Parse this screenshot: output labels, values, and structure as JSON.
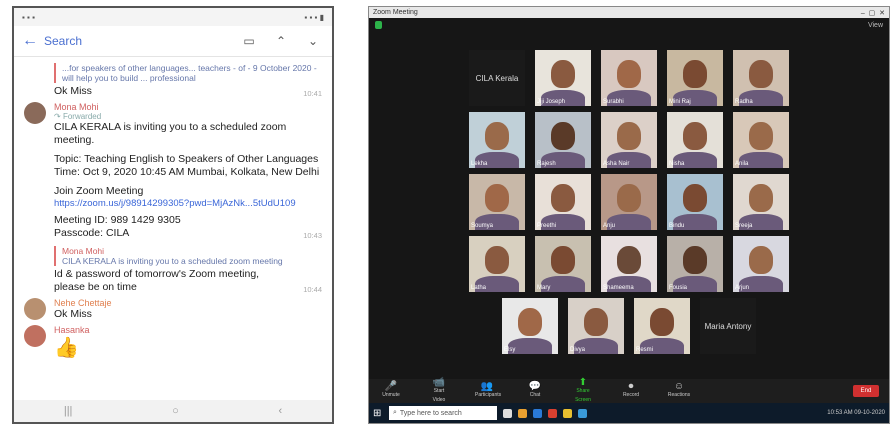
{
  "phone": {
    "topbar": {
      "search_label": "Search"
    },
    "messages": [
      {
        "type": "quote",
        "text": "...for speakers of other languages... teachers - of - 9 October 2020 - will help you to build ... professional"
      },
      {
        "type": "plain",
        "text": "Ok Miss",
        "time": "10:41"
      },
      {
        "type": "message",
        "sender": "Mona Mohi",
        "forwarded": "Forwarded",
        "lines": [
          "CILA KERALA is inviting you to a scheduled zoom meeting.",
          "",
          "Topic: Teaching English to Speakers of Other Languages",
          "Time: Oct 9, 2020 10:45 AM Mumbai, Kolkata, New Delhi",
          "",
          "Join Zoom Meeting"
        ],
        "link": "https://zoom.us/j/98914299305?pwd=MjAzNk...5tUdU109",
        "meeting_id": "Meeting ID: 989 1429 9305",
        "passcode": "Passcode: CILA",
        "time": "10:43"
      },
      {
        "type": "quote",
        "sender": "Mona Mohi",
        "text": "CILA KERALA is inviting you to a scheduled zoom meeting"
      },
      {
        "type": "plain",
        "text": "Id & password of tomorrow's Zoom meeting, please be on time",
        "time": "10:44"
      },
      {
        "type": "message-short",
        "sender": "Nehe Chettaje",
        "text": "Ok Miss"
      },
      {
        "type": "message-short",
        "sender": "Hasanka",
        "text": "👍"
      }
    ]
  },
  "zoom": {
    "window_title": "Zoom Meeting",
    "view_label": "View",
    "participants": [
      {
        "row": 0,
        "name": "CILA Kerala",
        "blank": true
      },
      {
        "row": 0,
        "name": "Jiji Joseph",
        "skin": "#8a5a40",
        "bg": "#e8e4dc"
      },
      {
        "row": 0,
        "name": "Surabhi",
        "skin": "#a06848",
        "bg": "#d8c8c0"
      },
      {
        "row": 0,
        "name": "Mini Raj",
        "skin": "#7a4a32",
        "bg": "#c8b8a0"
      },
      {
        "row": 0,
        "name": "Radha",
        "skin": "#8a5a40",
        "bg": "#d0c0b0"
      },
      {
        "row": 1,
        "name": "Lekha",
        "skin": "#9a6a4a",
        "bg": "#c0d0d8"
      },
      {
        "row": 1,
        "name": "Rajesh",
        "skin": "#5a3a28",
        "bg": "#b8c0c8"
      },
      {
        "row": 1,
        "name": "Asha Nair",
        "skin": "#9a6a4a",
        "bg": "#dcd0c8"
      },
      {
        "row": 1,
        "name": "Nisha",
        "skin": "#8a5a40",
        "bg": "#e4e0d8"
      },
      {
        "row": 1,
        "name": "Anila",
        "skin": "#9a6a4a",
        "bg": "#d8c8b8"
      },
      {
        "row": 2,
        "name": "Soumya",
        "skin": "#a06848",
        "bg": "#c8b8a8"
      },
      {
        "row": 2,
        "name": "Preethi",
        "skin": "#8a5a40",
        "bg": "#e8e0d8"
      },
      {
        "row": 2,
        "name": "Anju",
        "skin": "#9a6a4a",
        "bg": "#b89888"
      },
      {
        "row": 2,
        "name": "Bindu",
        "skin": "#7a4a32",
        "bg": "#a8c0d0"
      },
      {
        "row": 2,
        "name": "Sreeja",
        "skin": "#9a6a4a",
        "bg": "#e0d8d0"
      },
      {
        "row": 3,
        "name": "Latha",
        "skin": "#8a5a40",
        "bg": "#d8d0c0"
      },
      {
        "row": 3,
        "name": "Mary",
        "skin": "#7a4a32",
        "bg": "#c8c0b0"
      },
      {
        "row": 3,
        "name": "Shameema",
        "skin": "#6a4a38",
        "bg": "#e8e0e0"
      },
      {
        "row": 3,
        "name": "Fousia",
        "skin": "#5a3a28",
        "bg": "#b8b0a8"
      },
      {
        "row": 3,
        "name": "Arjun",
        "skin": "#9a6a4a",
        "bg": "#d8d8e0"
      },
      {
        "row": 4,
        "name": "Elsy",
        "skin": "#a06848",
        "bg": "#e8e8e8"
      },
      {
        "row": 4,
        "name": "Divya",
        "skin": "#8a5a40",
        "bg": "#d8d0c8"
      },
      {
        "row": 4,
        "name": "Resmi",
        "skin": "#7a4a32",
        "bg": "#e0d8c8"
      },
      {
        "row": 4,
        "name": "Maria Antony",
        "blank": true
      }
    ],
    "controls": [
      {
        "label": "Unmute",
        "icon": "🎤"
      },
      {
        "label": "Start Video",
        "icon": "📹"
      },
      {
        "label": "Participants",
        "icon": "👥"
      },
      {
        "label": "Chat",
        "icon": "💬"
      },
      {
        "label": "Share Screen",
        "icon": "⬆",
        "green": true
      },
      {
        "label": "Record",
        "icon": "⏺"
      },
      {
        "label": "Reactions",
        "icon": "☺"
      }
    ],
    "end_label": "End",
    "taskbar": {
      "search_placeholder": "Type here to search",
      "time": "10:53 AM",
      "date": "09-10-2020"
    }
  }
}
